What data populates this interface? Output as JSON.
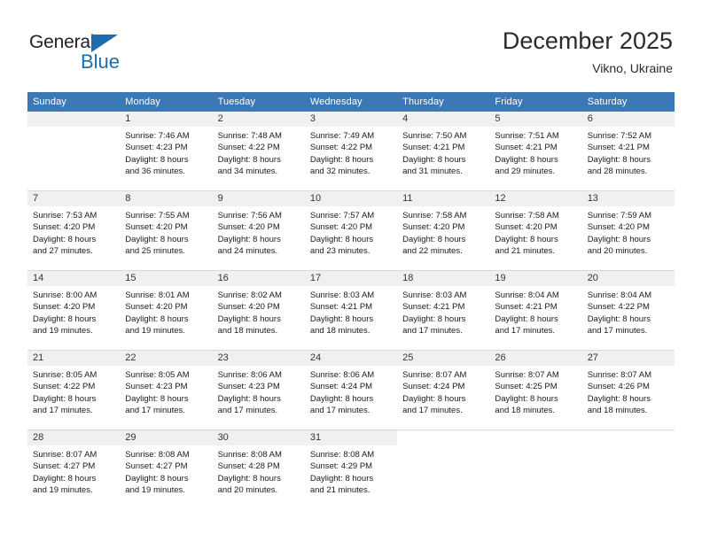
{
  "logo": {
    "word_top": "General",
    "word_bottom": "Blue",
    "triangle_color": "#1b6cb0"
  },
  "header": {
    "title": "December 2025",
    "subtitle": "Vikno, Ukraine"
  },
  "theme": {
    "header_blue": "#3c78b4",
    "daynum_band": "#f0f0f0",
    "grid_line": "#d9d9d9"
  },
  "weekday_headers": [
    "Sunday",
    "Monday",
    "Tuesday",
    "Wednesday",
    "Thursday",
    "Friday",
    "Saturday"
  ],
  "labels": {
    "sunrise": "Sunrise:",
    "sunset": "Sunset:",
    "daylight": "Daylight:"
  },
  "weeks": [
    [
      {
        "day": "",
        "empty": true
      },
      {
        "day": "1",
        "line1": "Sunrise: 7:46 AM",
        "line2": "Sunset: 4:23 PM",
        "line3": "Daylight: 8 hours",
        "line4": "and 36 minutes."
      },
      {
        "day": "2",
        "line1": "Sunrise: 7:48 AM",
        "line2": "Sunset: 4:22 PM",
        "line3": "Daylight: 8 hours",
        "line4": "and 34 minutes."
      },
      {
        "day": "3",
        "line1": "Sunrise: 7:49 AM",
        "line2": "Sunset: 4:22 PM",
        "line3": "Daylight: 8 hours",
        "line4": "and 32 minutes."
      },
      {
        "day": "4",
        "line1": "Sunrise: 7:50 AM",
        "line2": "Sunset: 4:21 PM",
        "line3": "Daylight: 8 hours",
        "line4": "and 31 minutes."
      },
      {
        "day": "5",
        "line1": "Sunrise: 7:51 AM",
        "line2": "Sunset: 4:21 PM",
        "line3": "Daylight: 8 hours",
        "line4": "and 29 minutes."
      },
      {
        "day": "6",
        "line1": "Sunrise: 7:52 AM",
        "line2": "Sunset: 4:21 PM",
        "line3": "Daylight: 8 hours",
        "line4": "and 28 minutes."
      }
    ],
    [
      {
        "day": "7",
        "line1": "Sunrise: 7:53 AM",
        "line2": "Sunset: 4:20 PM",
        "line3": "Daylight: 8 hours",
        "line4": "and 27 minutes."
      },
      {
        "day": "8",
        "line1": "Sunrise: 7:55 AM",
        "line2": "Sunset: 4:20 PM",
        "line3": "Daylight: 8 hours",
        "line4": "and 25 minutes."
      },
      {
        "day": "9",
        "line1": "Sunrise: 7:56 AM",
        "line2": "Sunset: 4:20 PM",
        "line3": "Daylight: 8 hours",
        "line4": "and 24 minutes."
      },
      {
        "day": "10",
        "line1": "Sunrise: 7:57 AM",
        "line2": "Sunset: 4:20 PM",
        "line3": "Daylight: 8 hours",
        "line4": "and 23 minutes."
      },
      {
        "day": "11",
        "line1": "Sunrise: 7:58 AM",
        "line2": "Sunset: 4:20 PM",
        "line3": "Daylight: 8 hours",
        "line4": "and 22 minutes."
      },
      {
        "day": "12",
        "line1": "Sunrise: 7:58 AM",
        "line2": "Sunset: 4:20 PM",
        "line3": "Daylight: 8 hours",
        "line4": "and 21 minutes."
      },
      {
        "day": "13",
        "line1": "Sunrise: 7:59 AM",
        "line2": "Sunset: 4:20 PM",
        "line3": "Daylight: 8 hours",
        "line4": "and 20 minutes."
      }
    ],
    [
      {
        "day": "14",
        "line1": "Sunrise: 8:00 AM",
        "line2": "Sunset: 4:20 PM",
        "line3": "Daylight: 8 hours",
        "line4": "and 19 minutes."
      },
      {
        "day": "15",
        "line1": "Sunrise: 8:01 AM",
        "line2": "Sunset: 4:20 PM",
        "line3": "Daylight: 8 hours",
        "line4": "and 19 minutes."
      },
      {
        "day": "16",
        "line1": "Sunrise: 8:02 AM",
        "line2": "Sunset: 4:20 PM",
        "line3": "Daylight: 8 hours",
        "line4": "and 18 minutes."
      },
      {
        "day": "17",
        "line1": "Sunrise: 8:03 AM",
        "line2": "Sunset: 4:21 PM",
        "line3": "Daylight: 8 hours",
        "line4": "and 18 minutes."
      },
      {
        "day": "18",
        "line1": "Sunrise: 8:03 AM",
        "line2": "Sunset: 4:21 PM",
        "line3": "Daylight: 8 hours",
        "line4": "and 17 minutes."
      },
      {
        "day": "19",
        "line1": "Sunrise: 8:04 AM",
        "line2": "Sunset: 4:21 PM",
        "line3": "Daylight: 8 hours",
        "line4": "and 17 minutes."
      },
      {
        "day": "20",
        "line1": "Sunrise: 8:04 AM",
        "line2": "Sunset: 4:22 PM",
        "line3": "Daylight: 8 hours",
        "line4": "and 17 minutes."
      }
    ],
    [
      {
        "day": "21",
        "line1": "Sunrise: 8:05 AM",
        "line2": "Sunset: 4:22 PM",
        "line3": "Daylight: 8 hours",
        "line4": "and 17 minutes."
      },
      {
        "day": "22",
        "line1": "Sunrise: 8:05 AM",
        "line2": "Sunset: 4:23 PM",
        "line3": "Daylight: 8 hours",
        "line4": "and 17 minutes."
      },
      {
        "day": "23",
        "line1": "Sunrise: 8:06 AM",
        "line2": "Sunset: 4:23 PM",
        "line3": "Daylight: 8 hours",
        "line4": "and 17 minutes."
      },
      {
        "day": "24",
        "line1": "Sunrise: 8:06 AM",
        "line2": "Sunset: 4:24 PM",
        "line3": "Daylight: 8 hours",
        "line4": "and 17 minutes."
      },
      {
        "day": "25",
        "line1": "Sunrise: 8:07 AM",
        "line2": "Sunset: 4:24 PM",
        "line3": "Daylight: 8 hours",
        "line4": "and 17 minutes."
      },
      {
        "day": "26",
        "line1": "Sunrise: 8:07 AM",
        "line2": "Sunset: 4:25 PM",
        "line3": "Daylight: 8 hours",
        "line4": "and 18 minutes."
      },
      {
        "day": "27",
        "line1": "Sunrise: 8:07 AM",
        "line2": "Sunset: 4:26 PM",
        "line3": "Daylight: 8 hours",
        "line4": "and 18 minutes."
      }
    ],
    [
      {
        "day": "28",
        "line1": "Sunrise: 8:07 AM",
        "line2": "Sunset: 4:27 PM",
        "line3": "Daylight: 8 hours",
        "line4": "and 19 minutes."
      },
      {
        "day": "29",
        "line1": "Sunrise: 8:08 AM",
        "line2": "Sunset: 4:27 PM",
        "line3": "Daylight: 8 hours",
        "line4": "and 19 minutes."
      },
      {
        "day": "30",
        "line1": "Sunrise: 8:08 AM",
        "line2": "Sunset: 4:28 PM",
        "line3": "Daylight: 8 hours",
        "line4": "and 20 minutes."
      },
      {
        "day": "31",
        "line1": "Sunrise: 8:08 AM",
        "line2": "Sunset: 4:29 PM",
        "line3": "Daylight: 8 hours",
        "line4": "and 21 minutes."
      },
      {
        "day": "",
        "empty": true,
        "blank": true
      },
      {
        "day": "",
        "empty": true,
        "blank": true
      },
      {
        "day": "",
        "empty": true,
        "blank": true
      }
    ]
  ]
}
